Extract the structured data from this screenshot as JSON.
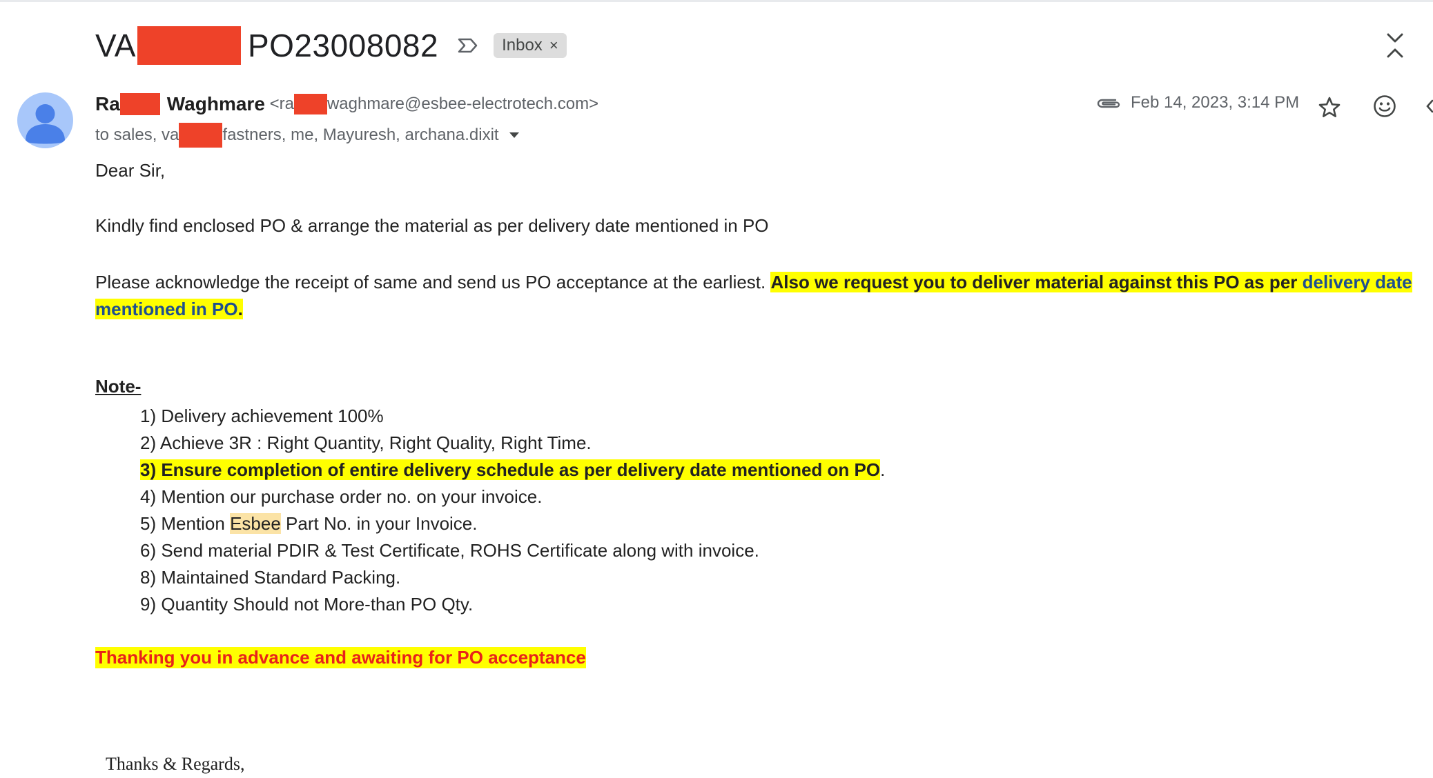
{
  "subject": {
    "prefix": "VA",
    "suffix": "PO23008082"
  },
  "label_badge": "Inbox",
  "label_remove": "×",
  "sender": {
    "name_prefix": "Ra",
    "name_suffix": "Waghmare",
    "email_prefix": "<ra",
    "email_suffix": "waghmare@esbee-electrotech.com>"
  },
  "recipients": {
    "prefix": "to sales, va",
    "suffix": "fastners, me, Mayuresh, archana.dixit"
  },
  "date": "Feb 14, 2023, 3:14 PM",
  "body": {
    "greeting": "Dear Sir,",
    "para1": "Kindly find enclosed PO & arrange the material as per delivery date mentioned in PO",
    "para2_plain": "Please acknowledge the receipt of same and send us PO acceptance at the earliest. ",
    "para2_bold": "Also we request you to deliver material against this PO as per ",
    "para2_link": "delivery date mentioned in PO",
    "para2_end": ".",
    "note_title": "Note-",
    "notes": [
      "1) Delivery achievement 100%",
      "2) Achieve 3R : Right Quantity, Right Quality, Right Time.",
      "3) Ensure completion of entire delivery schedule as per delivery date mentioned on PO",
      "4) Mention our purchase order no. on your invoice.",
      "5) Mention ",
      "6) Send material PDIR & Test Certificate, ROHS Certificate along with invoice.",
      "8) Maintained Standard Packing.",
      "9) Quantity Should not More-than PO Qty."
    ],
    "note3_tail": ".",
    "note5_highlight": "Esbee",
    "note5_tail": " Part No. in your Invoice.",
    "closing": "Thanking you in advance and awaiting for PO acceptance",
    "signoff": "Thanks & Regards,"
  },
  "colors": {
    "redaction": "#ee4229",
    "highlight": "#ffff00",
    "closing_text": "#e8221a",
    "avatar": "#a8c7fa"
  },
  "icons": [
    "important-marker-icon",
    "close-icon",
    "collapse-icon",
    "avatar-icon",
    "chevron-down-icon",
    "attachment-icon",
    "star-icon",
    "emoji-icon",
    "reply-icon"
  ]
}
